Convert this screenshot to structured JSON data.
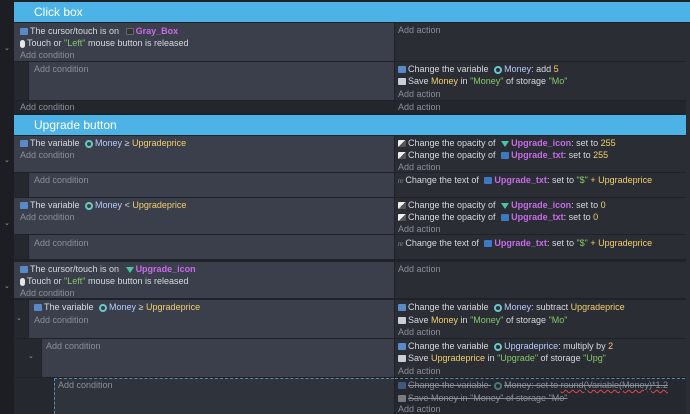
{
  "groups": [
    {
      "title": "Click box"
    },
    {
      "title": "Upgrade button"
    }
  ],
  "labels": {
    "add_action": "Add action",
    "add_condition": "Add condition"
  },
  "e1": {
    "c1_prefix": "The cursor/touch is on",
    "c1_obj": "Gray_Box",
    "c2_a": "Touch or",
    "c2_b": "\"Left\"",
    "c2_c": "mouse button is released"
  },
  "e2": {
    "a1_a": "Change the variable",
    "a1_var": "Money",
    "a1_b": ": add",
    "a1_val": "5",
    "a2_a": "Save",
    "a2_var": "Money",
    "a2_b": "in",
    "a2_s1": "\"Money\"",
    "a2_c": "of storage",
    "a2_s2": "\"Mo\""
  },
  "e3": {
    "c_a": "The variable",
    "c_var": "Money",
    "c_op": "≥",
    "c_val": "Upgradeprice",
    "a1_a": "Change the opacity of",
    "a1_obj": "Upgrade_icon",
    "a1_b": ": set to",
    "a1_val": "255",
    "a2_a": "Change the opacity of",
    "a2_obj": "Upgrade_txt",
    "a2_b": ": set to",
    "a2_val": "255"
  },
  "e4": {
    "a_a": "Change the text of",
    "a_obj": "Upgrade_txt",
    "a_b": ": set to",
    "a_s": "\"$\"",
    "a_c": "+ Upgradeprice"
  },
  "e5": {
    "c_a": "The variable",
    "c_var": "Money",
    "c_op": "<",
    "c_val": "Upgradeprice",
    "a1_a": "Change the opacity of",
    "a1_obj": "Upgrade_icon",
    "a1_b": ": set to",
    "a1_val": "0",
    "a2_a": "Change the opacity of",
    "a2_obj": "Upgrade_txt",
    "a2_b": ": set to",
    "a2_val": "0"
  },
  "e6": {
    "a_a": "Change the text of",
    "a_obj": "Upgrade_txt",
    "a_b": ": set to",
    "a_s": "\"$\"",
    "a_c": "+ Upgradeprice"
  },
  "e7": {
    "c1_prefix": "The cursor/touch is on",
    "c1_obj": "Upgrade_icon",
    "c2_a": "Touch or",
    "c2_b": "\"Left\"",
    "c2_c": "mouse button is released"
  },
  "e8": {
    "c_a": "The variable",
    "c_var": "Money",
    "c_op": "≥",
    "c_val": "Upgradeprice",
    "a1_a": "Change the variable",
    "a1_var": "Money",
    "a1_b": ": subtract",
    "a1_val": "Upgradeprice",
    "a2_a": "Save",
    "a2_var": "Money",
    "a2_b": "in",
    "a2_s1": "\"Money\"",
    "a2_c": "of storage",
    "a2_s2": "\"Mo\""
  },
  "e9": {
    "a1_a": "Change the variable",
    "a1_var": "Upgradeprice",
    "a1_b": ": multiply by",
    "a1_val": "2",
    "a2_a": "Save",
    "a2_var": "Upgradeprice",
    "a2_b": "in",
    "a2_s1": "\"Upgrade\"",
    "a2_c": "of storage",
    "a2_s2": "\"Upg\""
  },
  "e10": {
    "a1_a": "Change the variable",
    "a1_var": "Money",
    "a1_b": ": set to",
    "a1_val": "round(Variable(Money)*1.2",
    "a2_a": "Save",
    "a2_var": "Money",
    "a2_b": "in",
    "a2_s1": "\"Money\"",
    "a2_c": "of storage",
    "a2_s2": "\"Mo\""
  }
}
